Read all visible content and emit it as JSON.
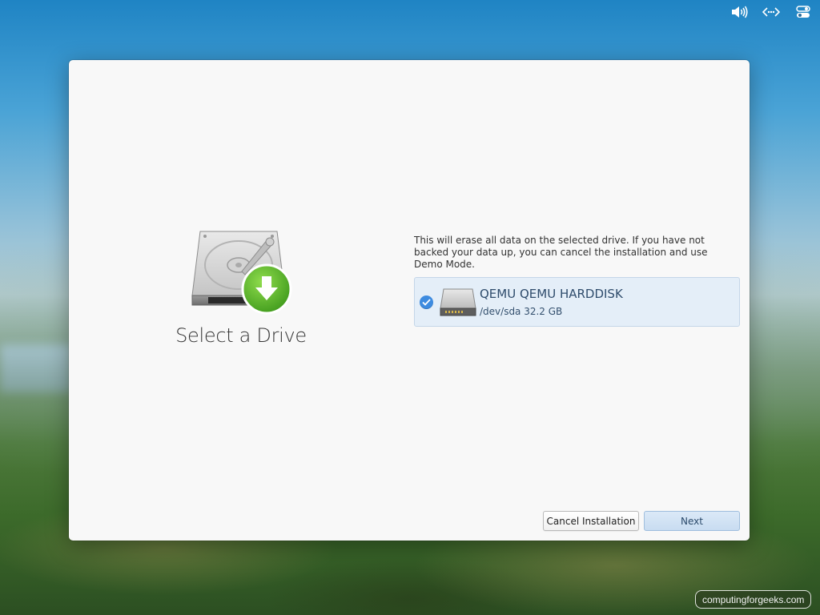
{
  "panel": {
    "icons": [
      "volume-icon",
      "network-icon",
      "system-settings-icon"
    ]
  },
  "installer": {
    "left": {
      "title": "Select a Drive",
      "art_icon": "hard-drive-download-icon"
    },
    "description": "This will erase all data on the selected drive. If you have not backed your data up, you can cancel the installation and use Demo Mode.",
    "drives": [
      {
        "name": "QEMU QEMU HARDDISK",
        "detail": "/dev/sda 32.2 GB",
        "selected": true,
        "icon": "hard-disk-icon"
      }
    ],
    "buttons": {
      "cancel_label": "Cancel Installation",
      "next_label": "Next"
    }
  },
  "watermark": {
    "text": "computingforgeeks.com"
  },
  "colors": {
    "accent": "#3d8be0",
    "selection_bg": "#e4eef8",
    "suggested_action_bg": "#c8dcf1",
    "download_green": "#5cbc2a"
  }
}
